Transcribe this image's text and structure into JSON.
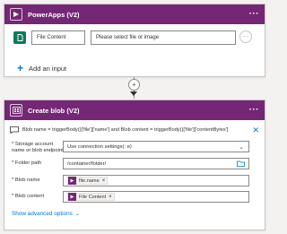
{
  "powerapps": {
    "title": "PowerApps (V2)",
    "input_name": "File Content",
    "input_placeholder": "Please select file or image",
    "row_more": "···",
    "add_input_label": "Add an input",
    "more_menu": "···"
  },
  "blob": {
    "title": "Create blob (V2)",
    "more_menu": "···",
    "info_text": "Blob name = triggerBody()['file']['name'] and Blob content = triggerBody()['file']['contentBytes']",
    "fields": {
      "storage_label": "* Storage account name or blob endpoint",
      "storage_value": "Use connection settings(:                          e)",
      "folder_label": "* Folder path",
      "folder_value": "/container/folder/",
      "name_label": "* Blob name",
      "name_token": "file.name",
      "content_label": "* Blob content",
      "content_token": "File Content"
    },
    "show_advanced": "Show advanced options"
  },
  "colors": {
    "header": "#742774",
    "accent": "#0078d4",
    "input_icon": "#0e7a5a"
  }
}
